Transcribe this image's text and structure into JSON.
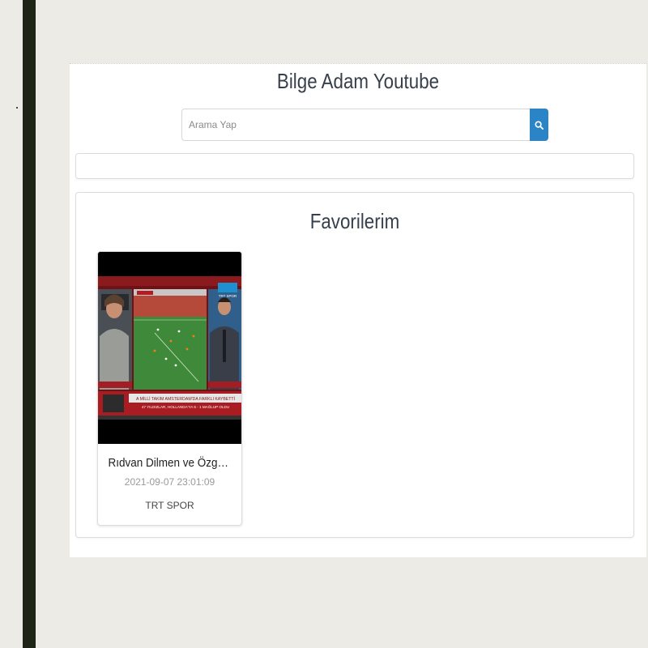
{
  "header": {
    "title": "Bilge Adam Youtube"
  },
  "search": {
    "placeholder": "Arama Yap",
    "value": "",
    "button_icon": "search-icon"
  },
  "favorites": {
    "title": "Favorilerim",
    "videos": [
      {
        "title": "Rıdvan Dilmen ve Özgür Buzbaş...",
        "date": "2021-09-07 23:01:09",
        "channel": "TRT SPOR",
        "thumbnail": {
          "channel_logo": "TRT SPOR",
          "banner_headline": "A MİLLİ TAKIM AMSTERDAM'DA FARKLI KAYBETTİ",
          "banner_subline": "47 YILDIZLAR, HOLLANDA'YA 6 - 1 MAĞLUP OLDU"
        }
      }
    ]
  },
  "colors": {
    "accent": "#2a84c6",
    "page_bg": "#ecebe5",
    "sidebar": "#1e2416",
    "heading": "#363f4c"
  }
}
